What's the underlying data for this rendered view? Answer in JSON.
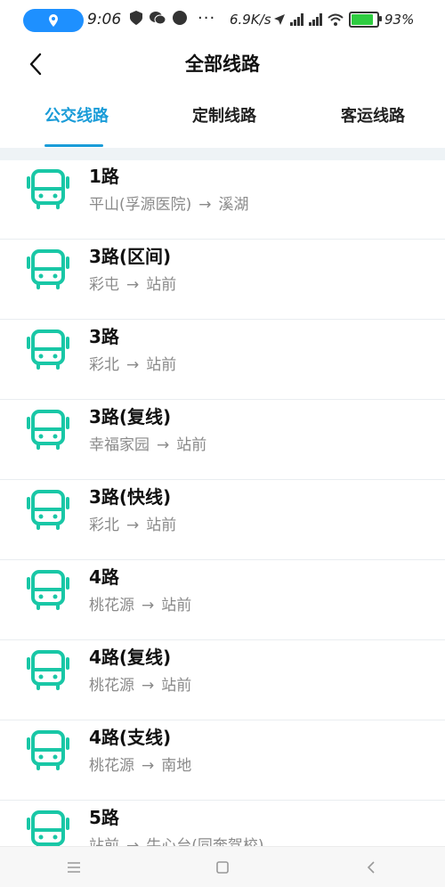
{
  "status_bar": {
    "time": "9:06",
    "more": "···",
    "net_speed": "6.9K/s",
    "battery_text": "93%",
    "battery_level": 0.93
  },
  "header": {
    "title": "全部线路"
  },
  "tabs": [
    {
      "label": "公交线路",
      "active": true
    },
    {
      "label": "定制线路",
      "active": false
    },
    {
      "label": "客运线路",
      "active": false
    }
  ],
  "routes": [
    {
      "name": "1路",
      "from": "平山(孚源医院)",
      "to": "溪湖"
    },
    {
      "name": "3路(区间)",
      "from": "彩屯",
      "to": "站前"
    },
    {
      "name": "3路",
      "from": "彩北",
      "to": "站前"
    },
    {
      "name": "3路(复线)",
      "from": "幸福家园",
      "to": "站前"
    },
    {
      "name": "3路(快线)",
      "from": "彩北",
      "to": "站前"
    },
    {
      "name": "4路",
      "from": "桃花源",
      "to": "站前"
    },
    {
      "name": "4路(复线)",
      "from": "桃花源",
      "to": "站前"
    },
    {
      "name": "4路(支线)",
      "from": "桃花源",
      "to": "南地"
    },
    {
      "name": "5路",
      "from": "站前",
      "to": "牛心台(同奔驾校)"
    }
  ],
  "arrow_symbol": "→",
  "colors": {
    "accent": "#1a9cd8",
    "bus_icon": "#19c7a6",
    "location_pill": "#1e90ff",
    "battery_fill": "#2ecc40"
  },
  "icons": {
    "back": "back-arrow-icon",
    "bus": "bus-icon",
    "menu": "menu-icon",
    "home": "home-square-icon",
    "nav_back": "nav-back-icon"
  }
}
